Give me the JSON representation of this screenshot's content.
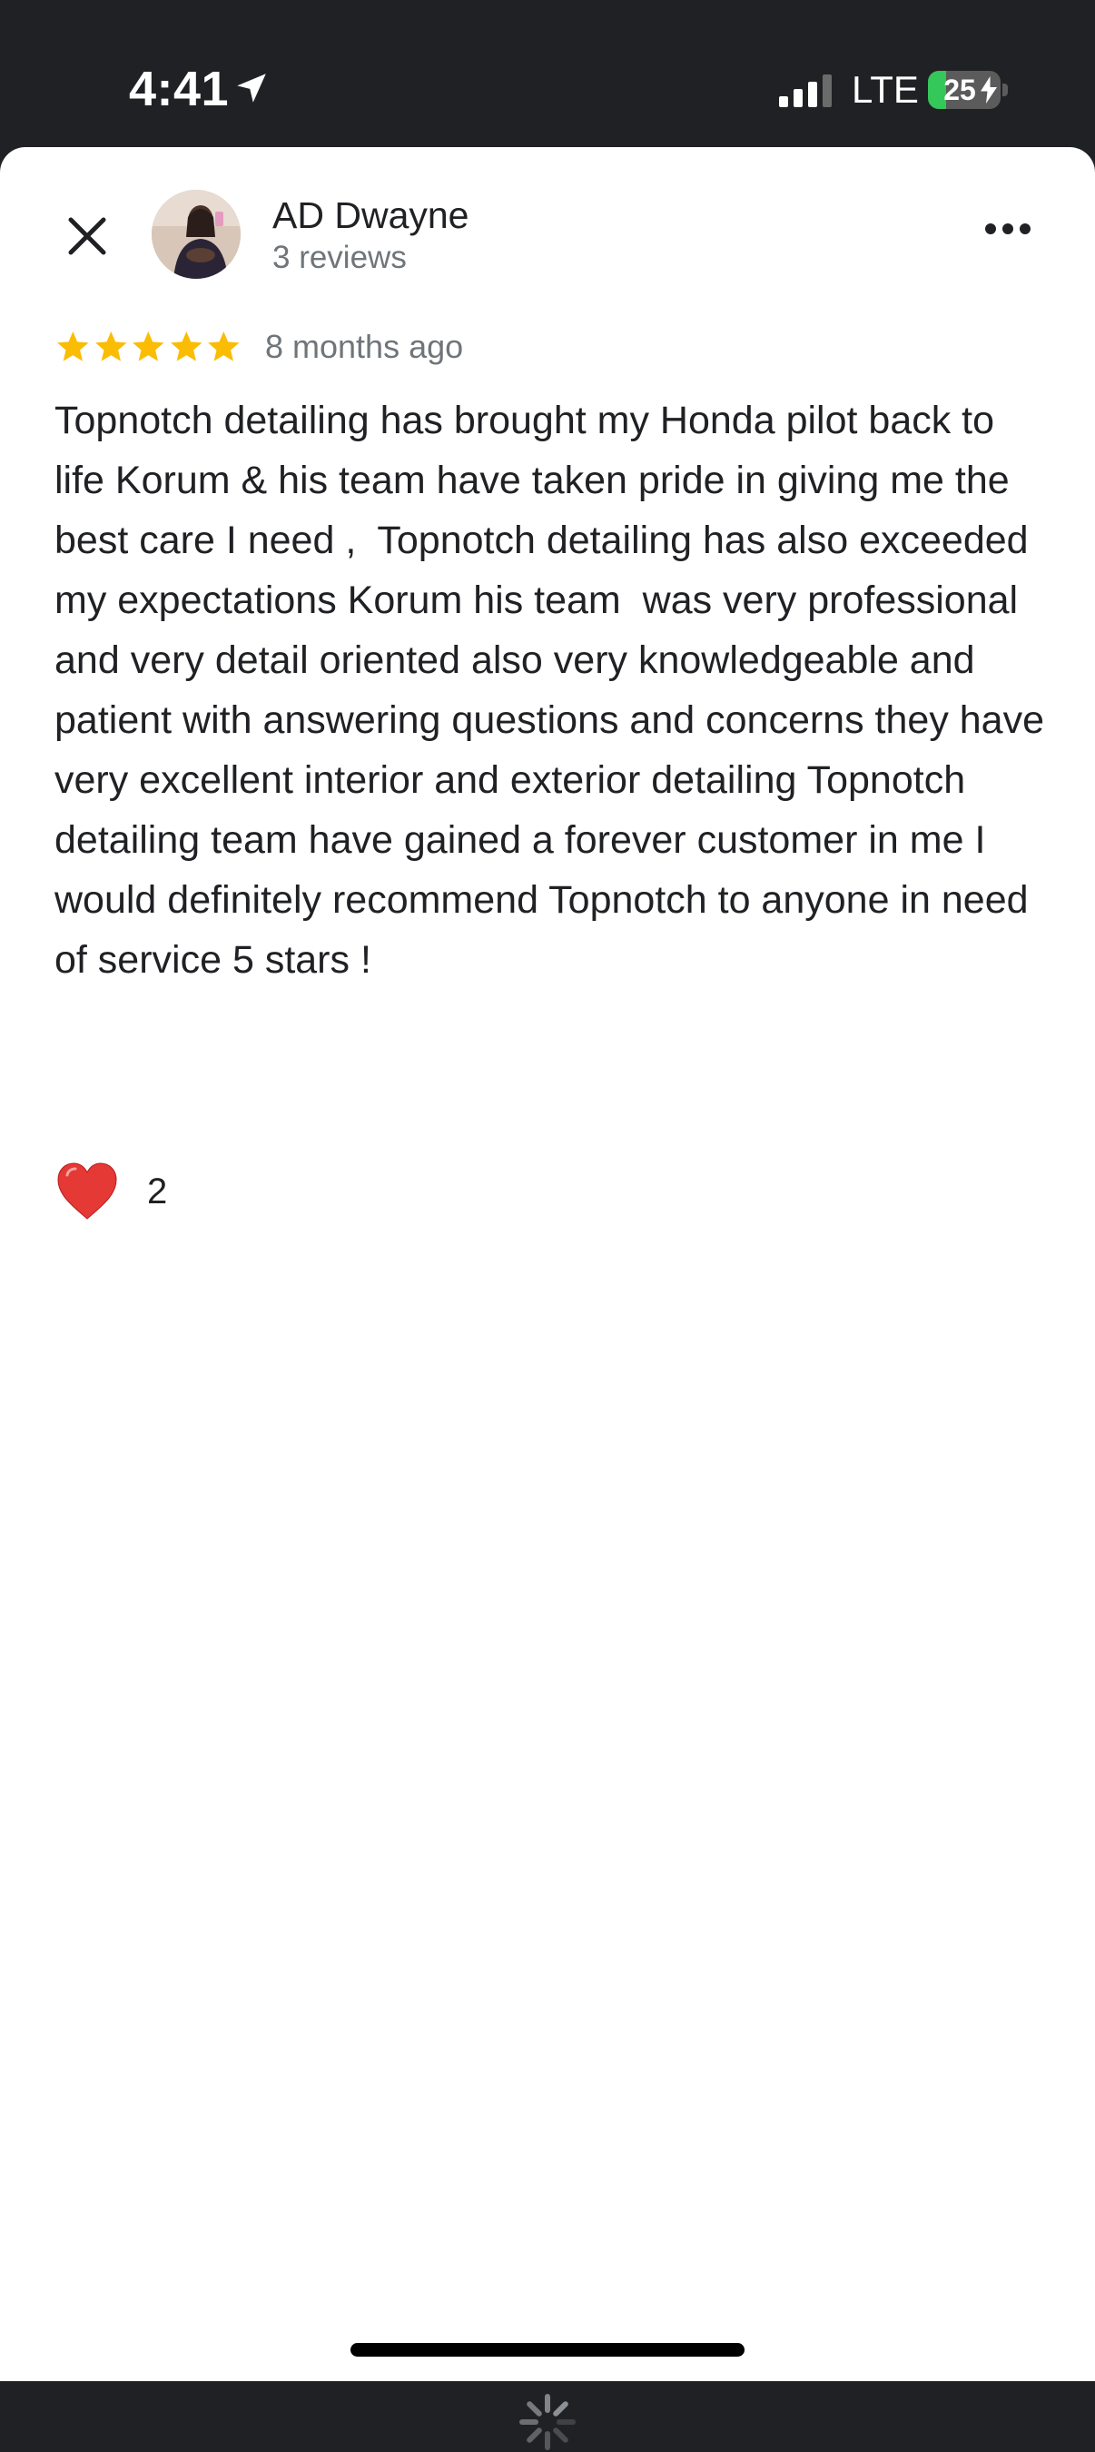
{
  "status_bar": {
    "time": "4:41",
    "network": "LTE",
    "battery_percent": 25,
    "battery_label": "25",
    "charging": true,
    "signal_bars_active": 3,
    "signal_bars_total": 4,
    "location_icon": "location-arrow-icon"
  },
  "review": {
    "reviewer_name": "AD Dwayne",
    "reviewer_meta": "3 reviews",
    "rating": 5,
    "max_rating": 5,
    "date": "8 months ago",
    "text": "Topnotch detailing has brought my Honda pilot back to life Korum & his team have taken pride in giving me the best care I need ,  Topnotch detailing has also exceeded my expectations Korum his team  was very professional and very detail oriented also very knowledgeable and patient with answering questions and concerns they have very excellent interior and exterior detailing Topnotch detailing team have gained a forever customer in me I would definitely recommend Topnotch to anyone in need of service 5 stars !",
    "reaction_icon": "heart-icon",
    "reaction_count": "2"
  },
  "icons": {
    "close": "close-icon",
    "more": "more-horizontal-icon",
    "loading": "spinner-icon"
  },
  "colors": {
    "status_bar_bg": "#202124",
    "star": "#fbbc04",
    "primary_text": "#202124",
    "secondary_text": "#70757a",
    "heart": "#e53935",
    "battery_fill": "#34c759"
  }
}
